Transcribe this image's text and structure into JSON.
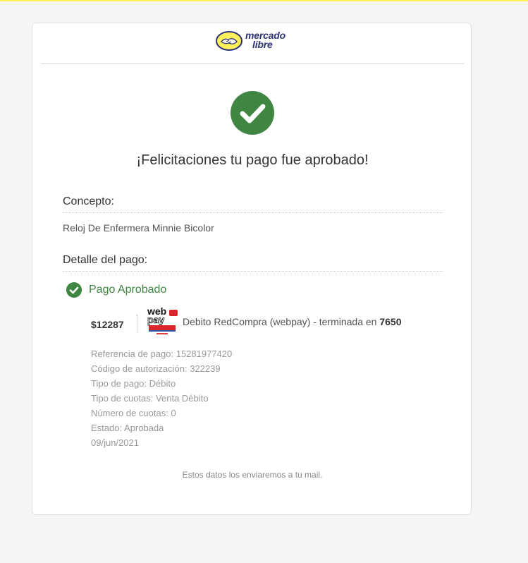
{
  "brand": {
    "line1": "mercado",
    "line2": "libre",
    "colors": {
      "yellow": "#fff159",
      "navy": "#2d3277"
    }
  },
  "title": "¡Felicitaciones tu pago fue aprobado!",
  "concept": {
    "label": "Concepto:",
    "value": "Reloj De Enfermera Minnie Bicolor"
  },
  "payment_detail": {
    "label": "Detalle del pago:",
    "status_label": "Pago Aprobado",
    "status_color": "#3f8642",
    "amount": "$12287",
    "method_icon": "webpay-logo",
    "method_prefix": "Debito RedCompra (webpay) - terminada en",
    "card_last4": "7650",
    "lines": [
      {
        "label": "Referencia de pago:",
        "value": "15281977420"
      },
      {
        "label": "Código de autorización:",
        "value": "322239"
      },
      {
        "label": "Tipo de pago:",
        "value": "Débito"
      },
      {
        "label": "Tipo de cuotas:",
        "value": "Venta Débito"
      },
      {
        "label": "Número de cuotas:",
        "value": "0"
      },
      {
        "label": "Estado:",
        "value": "Aprobada"
      }
    ],
    "date": "09/jun/2021"
  },
  "footer_note": "Estos datos los enviaremos a tu mail."
}
